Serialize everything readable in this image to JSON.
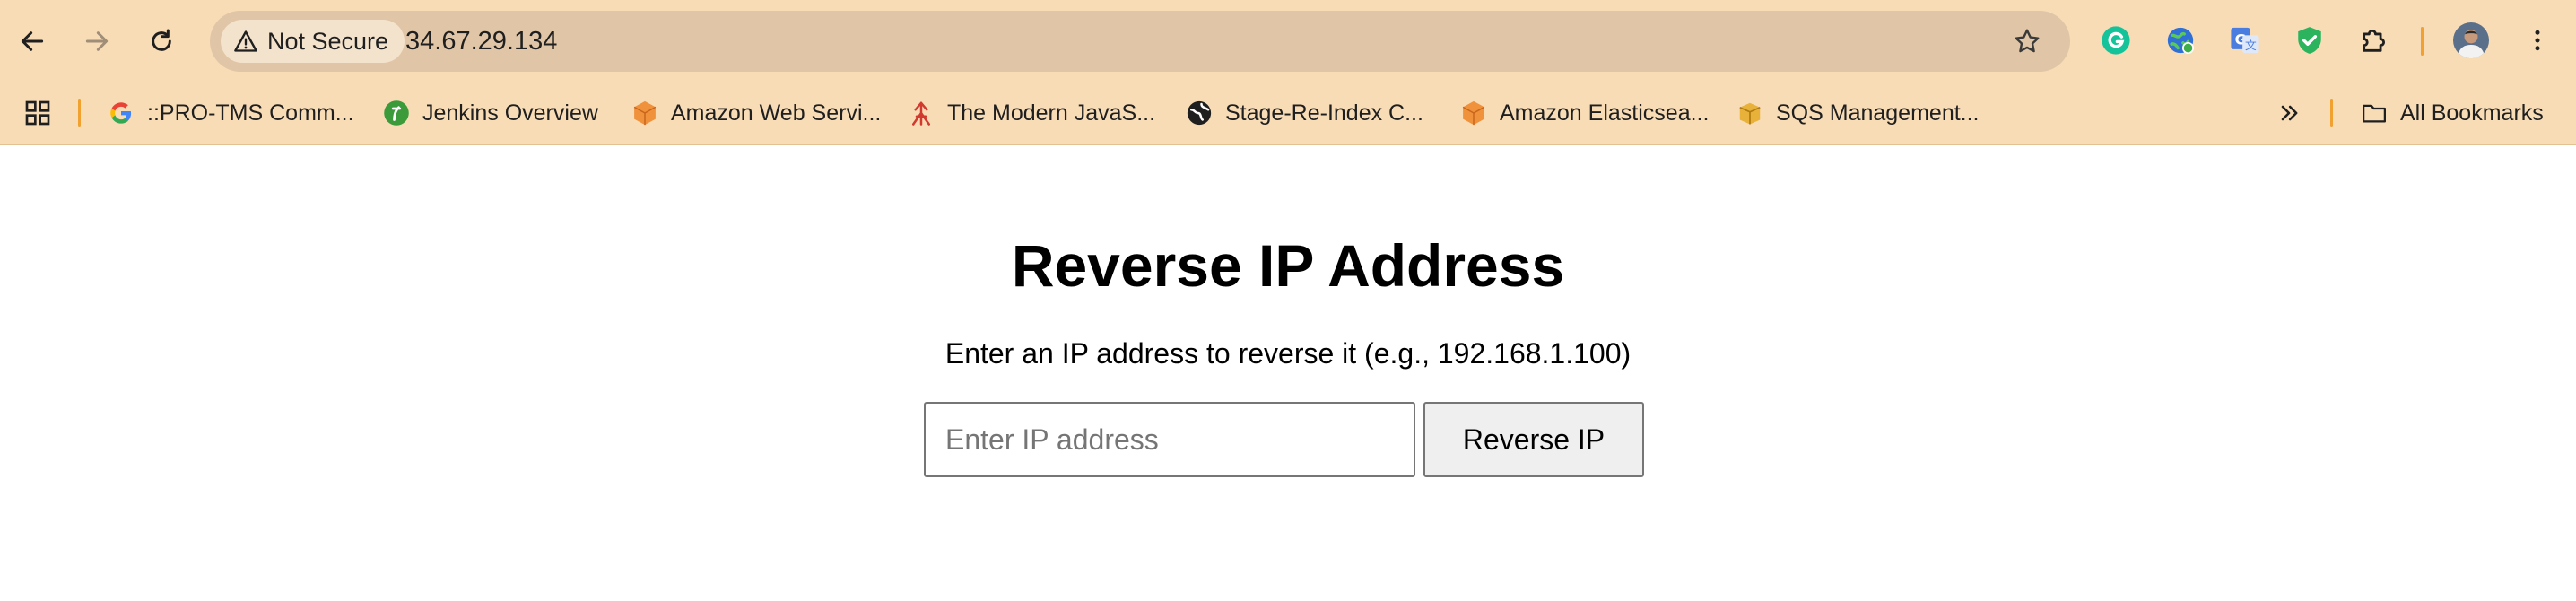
{
  "browser": {
    "security_chip": "Not Secure",
    "url": "34.67.29.134",
    "bookmarks": [
      {
        "label": "::PRO-TMS Comm...",
        "icon": "google-icon"
      },
      {
        "label": "Jenkins Overview",
        "icon": "jenkins-icon"
      },
      {
        "label": "Amazon Web Servi...",
        "icon": "aws-icon"
      },
      {
        "label": "The Modern JavaS...",
        "icon": "javascript-info-icon"
      },
      {
        "label": "Stage-Re-Index C...",
        "icon": "globe-icon"
      },
      {
        "label": "Amazon Elasticsea...",
        "icon": "aws-icon"
      },
      {
        "label": "SQS Management...",
        "icon": "sqs-icon"
      }
    ],
    "all_bookmarks": "All Bookmarks"
  },
  "page": {
    "title": "Reverse IP Address",
    "subtitle": "Enter an IP address to reverse it (e.g., 192.168.1.100)",
    "input_placeholder": "Enter IP address",
    "input_value": "",
    "button_label": "Reverse IP"
  },
  "colors": {
    "toolbar_bg": "#f8dcb6",
    "omnibox_bg": "#e0c6a6",
    "accent_divider": "#f0a130"
  }
}
